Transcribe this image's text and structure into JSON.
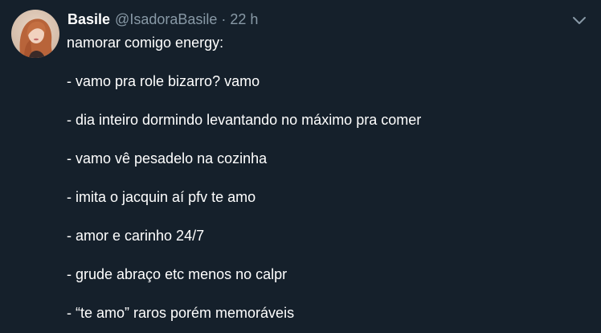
{
  "tweet": {
    "author": {
      "display_name": "Basile",
      "handle": "@IsadoraBasile",
      "avatar_icon": "profile-photo"
    },
    "separator": "·",
    "time": "22 h",
    "menu_icon": "chevron-down-icon",
    "text": {
      "intro": "namorar comigo energy:",
      "items": [
        "- vamo pra role bizarro? vamo",
        "- dia inteiro dormindo levantando no máximo pra comer",
        "- vamo vê pesadelo na cozinha",
        "- imita o jacquin aí pfv te amo",
        "- amor e carinho 24/7",
        "- grude abraço etc menos no calpr",
        "- “te amo” raros porém memoráveis"
      ]
    },
    "colors": {
      "background": "#15202b",
      "text": "#ffffff",
      "secondary_text": "#8899a6"
    }
  }
}
